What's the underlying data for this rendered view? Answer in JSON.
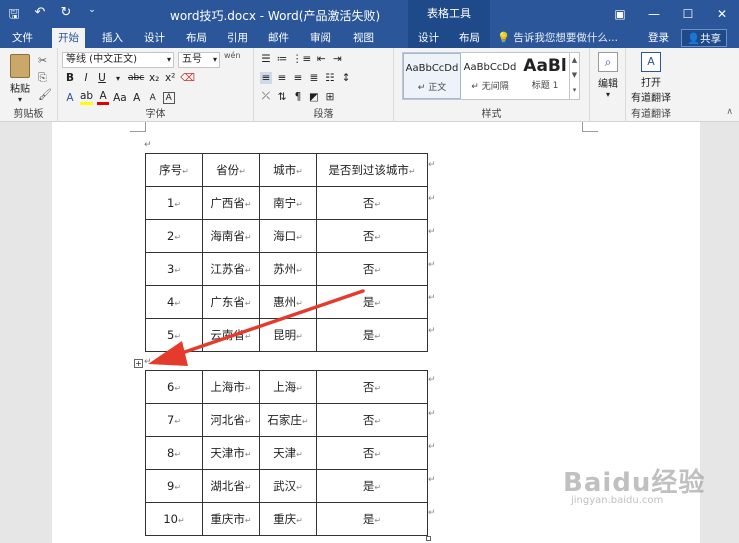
{
  "window": {
    "title": "word技巧.docx - Word(产品激活失败)",
    "contextual_tab_group": "表格工具"
  },
  "tabs": [
    "文件",
    "开始",
    "插入",
    "设计",
    "布局",
    "引用",
    "邮件",
    "审阅",
    "视图",
    "设计",
    "布局"
  ],
  "active_tab": "开始",
  "tell_me": "告诉我您想要做什么...",
  "account": {
    "login": "登录",
    "share": "共享"
  },
  "ribbon": {
    "clipboard": {
      "paste_label": "粘贴",
      "group_label": "剪贴板"
    },
    "font": {
      "font_name": "等线 (中文正文)",
      "font_size": "五号",
      "group_label": "字体",
      "buttons": [
        "B",
        "I",
        "U",
        "abc",
        "x₂",
        "x²",
        "A",
        "A",
        "Aa",
        "A",
        "A"
      ],
      "wen": "wén"
    },
    "paragraph": {
      "group_label": "段落"
    },
    "styles": {
      "group_label": "样式",
      "items": [
        {
          "preview": "AaBbCcDd",
          "name": "↵ 正文"
        },
        {
          "preview": "AaBbCcDd",
          "name": "↵ 无间隔"
        },
        {
          "preview": "AaBl",
          "name": "标题 1"
        }
      ]
    },
    "editing": {
      "label": "编辑"
    },
    "translate": {
      "label_line1": "打开",
      "label_line2": "有道翻译",
      "group_label": "有道翻译"
    }
  },
  "table": {
    "headers": [
      "序号",
      "省份",
      "城市",
      "是否到过该城市"
    ],
    "rows_part1": [
      [
        "1",
        "广西省",
        "南宁",
        "否"
      ],
      [
        "2",
        "海南省",
        "海口",
        "否"
      ],
      [
        "3",
        "江苏省",
        "苏州",
        "否"
      ],
      [
        "4",
        "广东省",
        "惠州",
        "是"
      ],
      [
        "5",
        "云南省",
        "昆明",
        "是"
      ]
    ],
    "rows_part2": [
      [
        "6",
        "上海市",
        "上海",
        "否"
      ],
      [
        "7",
        "河北省",
        "石家庄",
        "否"
      ],
      [
        "8",
        "天津市",
        "天津",
        "否"
      ],
      [
        "9",
        "湖北省",
        "武汉",
        "是"
      ],
      [
        "10",
        "重庆市",
        "重庆",
        "是"
      ]
    ]
  },
  "watermark": {
    "brand": "Baidu经验",
    "url": "jingyan.baidu.com"
  },
  "colors": {
    "accent": "#2b579a",
    "arrow": "#e53b2c"
  }
}
